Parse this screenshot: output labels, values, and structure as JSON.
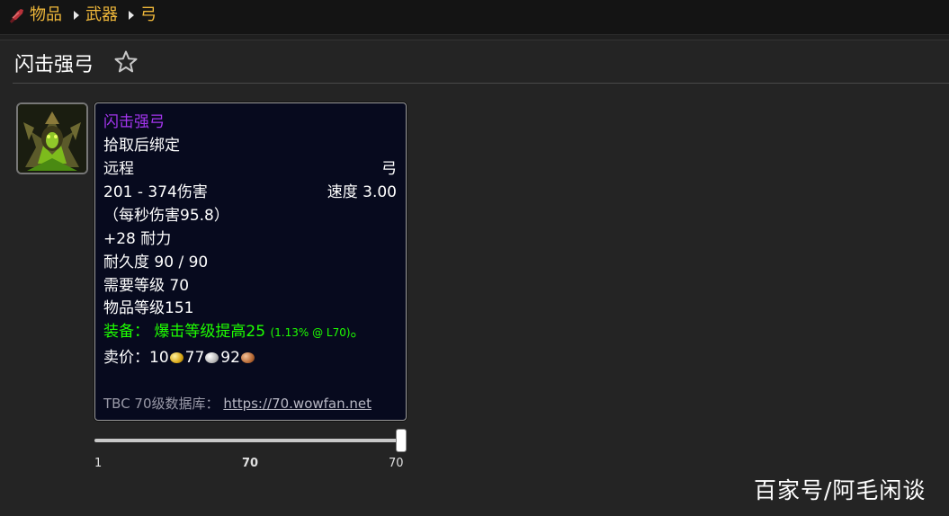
{
  "breadcrumb": {
    "icon": "weapon-category-icon",
    "items": [
      "物品",
      "武器",
      "弓"
    ]
  },
  "page": {
    "title": "闪击强弓",
    "favorite_icon": "star-outline-icon"
  },
  "item": {
    "icon": "item-portrait-icon",
    "name": "闪击强弓",
    "binding": "拾取后绑定",
    "slot": "远程",
    "type": "弓",
    "damage": "201 - 374伤害",
    "speed": "速度 3.00",
    "dps": "（每秒伤害95.8）",
    "stamina": "+28 耐力",
    "durability": "耐久度 90 / 90",
    "required_level": "需要等级 70",
    "item_level": "物品等级151",
    "equip_label": "装备：",
    "equip_effect": "爆击等级提高25",
    "equip_note": "(1.13% @ L70)",
    "equip_end": "。",
    "sell_label": "卖价：",
    "sell_gold": "10",
    "sell_silver": "77",
    "sell_copper": "92",
    "db_label": "TBC 70级数据库：",
    "db_link": "https://70.wowfan.net"
  },
  "level_slider": {
    "min": "1",
    "current": "70",
    "max": "70",
    "value_fraction": 1.0
  },
  "watermark": "百家号/阿毛闲谈",
  "colors": {
    "epic_quality": "#a335ee",
    "equip_green": "#1eff00",
    "breadcrumb_gold": "#f0b83a",
    "tooltip_bg": "#070a1e"
  }
}
